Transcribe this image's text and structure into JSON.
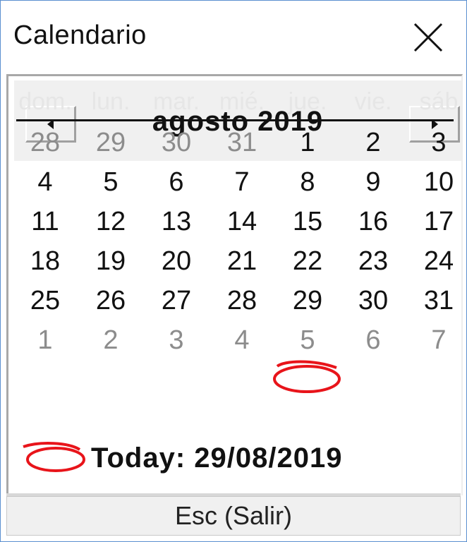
{
  "window": {
    "title": "Calendario"
  },
  "calendar": {
    "month_label": "agosto 2019",
    "weekdays": [
      "dom.",
      "lun.",
      "mar.",
      "mié.",
      "jue.",
      "vie.",
      "sáb"
    ],
    "weeks": [
      [
        {
          "d": "28",
          "m": true
        },
        {
          "d": "29",
          "m": true
        },
        {
          "d": "30",
          "m": true
        },
        {
          "d": "31",
          "m": true
        },
        {
          "d": "1",
          "m": false
        },
        {
          "d": "2",
          "m": false
        },
        {
          "d": "3",
          "m": false
        }
      ],
      [
        {
          "d": "4",
          "m": false
        },
        {
          "d": "5",
          "m": false
        },
        {
          "d": "6",
          "m": false
        },
        {
          "d": "7",
          "m": false
        },
        {
          "d": "8",
          "m": false
        },
        {
          "d": "9",
          "m": false
        },
        {
          "d": "10",
          "m": false
        }
      ],
      [
        {
          "d": "11",
          "m": false
        },
        {
          "d": "12",
          "m": false
        },
        {
          "d": "13",
          "m": false
        },
        {
          "d": "14",
          "m": false
        },
        {
          "d": "15",
          "m": false
        },
        {
          "d": "16",
          "m": false
        },
        {
          "d": "17",
          "m": false
        }
      ],
      [
        {
          "d": "18",
          "m": false
        },
        {
          "d": "19",
          "m": false
        },
        {
          "d": "20",
          "m": false
        },
        {
          "d": "21",
          "m": false
        },
        {
          "d": "22",
          "m": false
        },
        {
          "d": "23",
          "m": false
        },
        {
          "d": "24",
          "m": false
        }
      ],
      [
        {
          "d": "25",
          "m": false
        },
        {
          "d": "26",
          "m": false
        },
        {
          "d": "27",
          "m": false
        },
        {
          "d": "28",
          "m": false
        },
        {
          "d": "29",
          "m": false,
          "today": true
        },
        {
          "d": "30",
          "m": false
        },
        {
          "d": "31",
          "m": false
        }
      ],
      [
        {
          "d": "1",
          "m": true
        },
        {
          "d": "2",
          "m": true
        },
        {
          "d": "3",
          "m": true
        },
        {
          "d": "4",
          "m": true
        },
        {
          "d": "5",
          "m": true
        },
        {
          "d": "6",
          "m": true
        },
        {
          "d": "7",
          "m": true
        }
      ]
    ],
    "today_label": "Today: 29/08/2019",
    "today_color": "#e8141a"
  },
  "footer": {
    "esc_label": "Esc (Salir)"
  },
  "icons": {
    "close": "close-icon",
    "prev": "triangle-left-icon",
    "next": "triangle-right-icon",
    "today_marker": "red-circle-marker-icon"
  }
}
